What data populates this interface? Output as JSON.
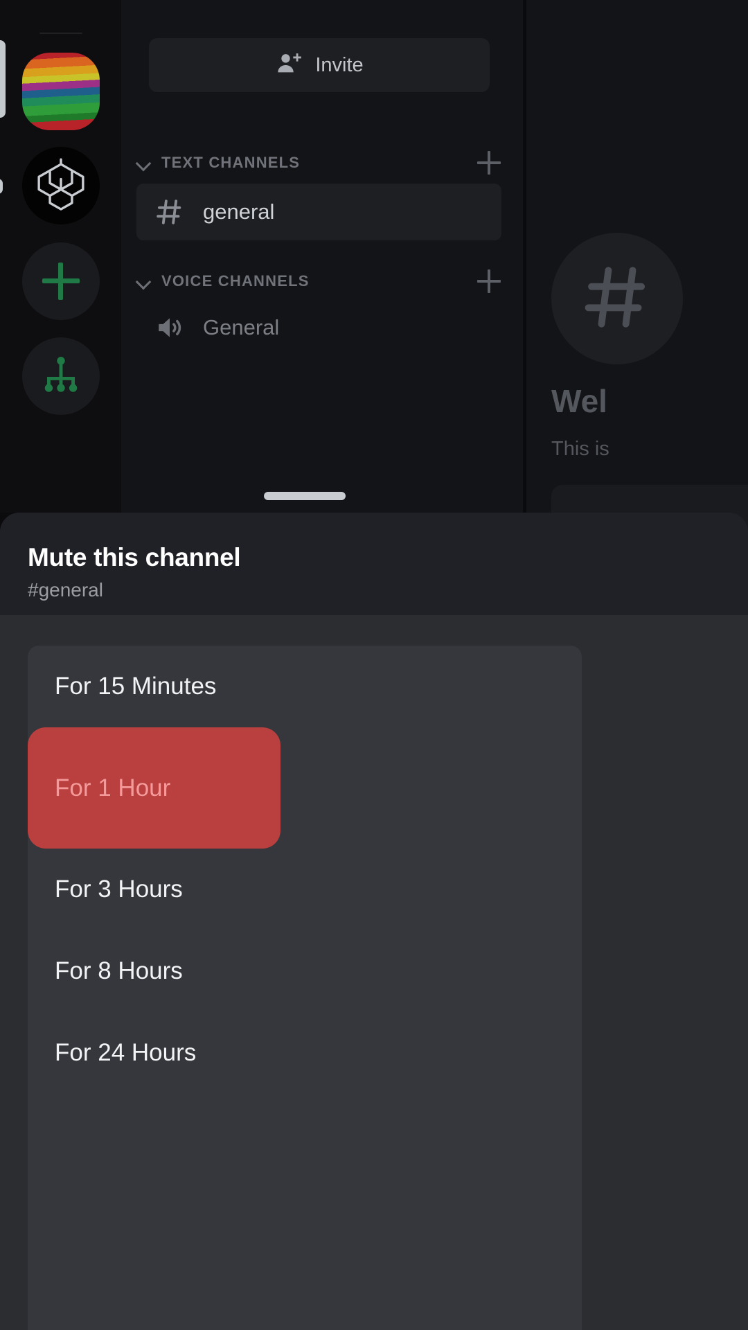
{
  "server_rail": {
    "items": [
      {
        "name": "pride-server",
        "label": "",
        "icon": "pride-flag-icon"
      },
      {
        "name": "openai-server",
        "label": "",
        "icon": "openai-logo-icon"
      },
      {
        "name": "add-server",
        "label": "",
        "icon": "plus-icon"
      },
      {
        "name": "discover-servers",
        "label": "",
        "icon": "compass-explore-icon"
      }
    ]
  },
  "channel_panel": {
    "invite": {
      "label": "Invite",
      "icon": "person-add-icon"
    },
    "categories": [
      {
        "label": "TEXT CHANNELS",
        "collapse_icon": "chevron-down-icon",
        "add_icon": "plus-icon",
        "channels": [
          {
            "name": "general",
            "icon": "hash-icon",
            "active": true
          }
        ]
      },
      {
        "label": "VOICE CHANNELS",
        "collapse_icon": "chevron-down-icon",
        "add_icon": "plus-icon",
        "channels": [
          {
            "name": "General",
            "icon": "speaker-icon",
            "active": false
          }
        ]
      }
    ]
  },
  "chat_area": {
    "hash_icon": "hash-icon",
    "welcome_heading": "Wel",
    "welcome_sub": "This is"
  },
  "sheet": {
    "drag_handle": "drag-handle",
    "title": "Mute this channel",
    "subtitle": "#general",
    "options": [
      {
        "label": "For 15 Minutes",
        "selected": false
      },
      {
        "label": "For 1 Hour",
        "selected": true
      },
      {
        "label": "For 3 Hours",
        "selected": false
      },
      {
        "label": "For 8 Hours",
        "selected": false
      },
      {
        "label": "For 24 Hours",
        "selected": false
      }
    ]
  },
  "colors": {
    "selected_background": "#b9403f",
    "selected_text": "#f49a9a",
    "sheet_background": "#2b2d31",
    "card_background": "#35373c",
    "accent_green": "#1f7a46"
  }
}
